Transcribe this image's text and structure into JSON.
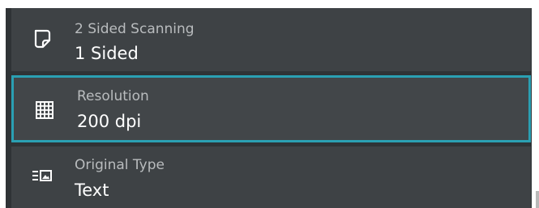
{
  "settings": [
    {
      "label": "2 Sided Scanning",
      "value": "1 Sided",
      "icon": "page-icon",
      "selected": false
    },
    {
      "label": "Resolution",
      "value": "200 dpi",
      "icon": "grid-icon",
      "selected": true
    },
    {
      "label": "Original Type",
      "value": "Text",
      "icon": "text-photo-icon",
      "selected": false
    }
  ],
  "colors": {
    "panel": "#2f3336",
    "row": "#3e4245",
    "selected_border": "#2aa0b3",
    "label": "#b9bcbe",
    "value": "#ffffff"
  }
}
